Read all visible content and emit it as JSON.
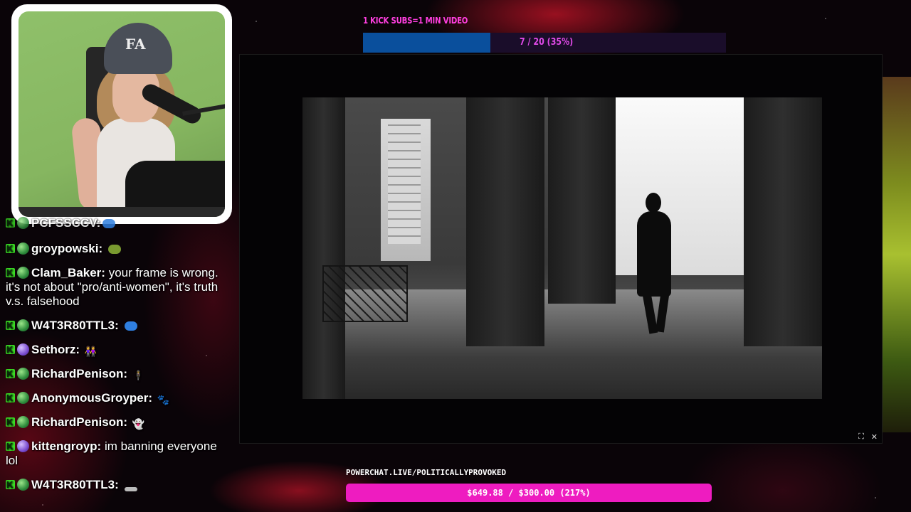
{
  "sub_goal": {
    "label": "1 KICK SUBS=1 MIN VIDEO",
    "progress_text": "7 / 20 (35%)",
    "fraction": 0.35,
    "fill_color": "#0a4f9c"
  },
  "webcam": {
    "cap_logo": "FA"
  },
  "chat": {
    "messages": [
      {
        "user": "PCFSSCCV:",
        "text": "",
        "emote": "blue-blob",
        "badge": "green"
      },
      {
        "user": "groypowski:",
        "text": "",
        "emote": "frog-emote",
        "badge": "green"
      },
      {
        "user": "Clam_Baker:",
        "text": "your frame is wrong. it's not about \"pro/anti-women\", it's truth v.s. falsehood",
        "emote": "",
        "badge": "green"
      },
      {
        "user": "W4T3R80TTL3:",
        "text": "",
        "emote": "blue-blob",
        "badge": "green"
      },
      {
        "user": "Sethorz:",
        "text": "",
        "emote": "people-emote",
        "badge": "purple"
      },
      {
        "user": "RichardPenison:",
        "text": "",
        "emote": "figure-emote",
        "badge": "green"
      },
      {
        "user": "AnonymousGroyper:",
        "text": "",
        "emote": "dog-emote",
        "badge": "green"
      },
      {
        "user": "RichardPenison:",
        "text": "",
        "emote": "ghost-emote",
        "badge": "green"
      },
      {
        "user": "kittengroyp:",
        "text": "im banning everyone lol",
        "emote": "",
        "badge": "purple"
      },
      {
        "user": "W4T3R80TTL3:",
        "text": "",
        "emote": "grey-blob",
        "badge": "green"
      }
    ]
  },
  "player": {
    "controls": [
      "fullscreen-icon",
      "settings-icon"
    ]
  },
  "powerchat": {
    "url": "POWERCHAT.LIVE/POLITICALLYPROVOKED",
    "progress_text": "$649.88 / $300.00 (217%)",
    "fraction": 1.0,
    "fill_color": "#ee1cc0"
  }
}
